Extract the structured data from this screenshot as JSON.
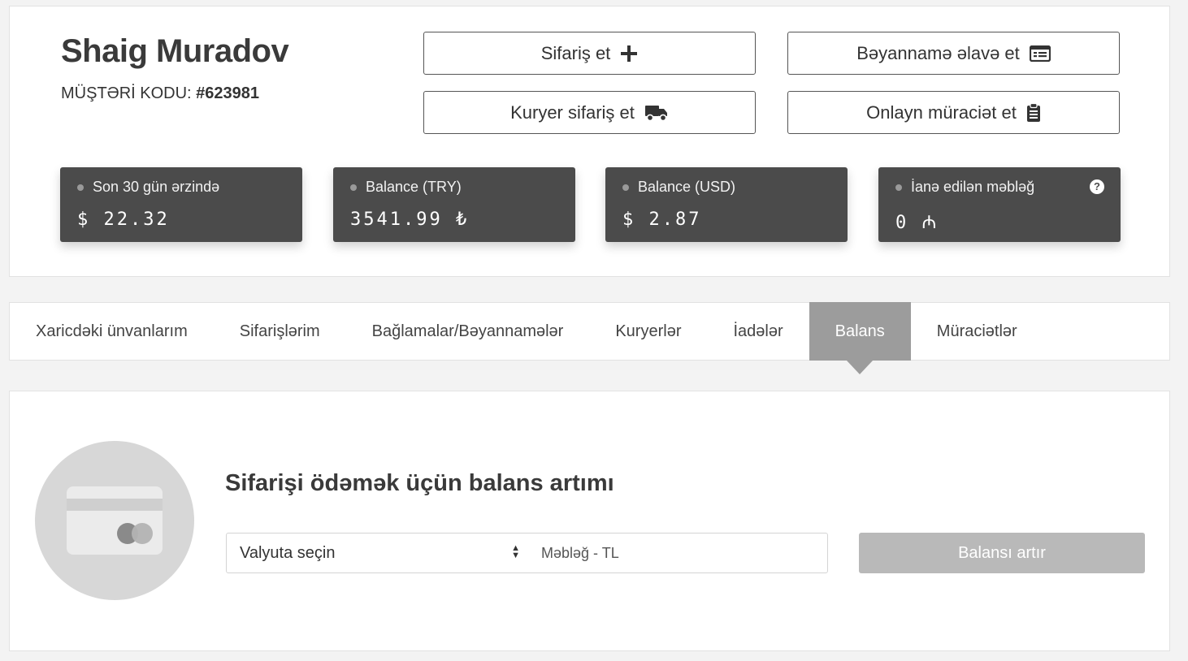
{
  "profile": {
    "name": "Shaig Muradov",
    "customer_code_label": "MÜŞTƏRİ KODU:",
    "customer_code": "#623981"
  },
  "actions": {
    "order_label": "Sifariş et",
    "declaration_label": "Bəyannamə əlavə et",
    "courier_label": "Kuryer sifariş et",
    "online_request_label": "Onlayn müraciət et"
  },
  "stats": [
    {
      "label": "Son 30 gün ərzində",
      "value": "$ 22.32"
    },
    {
      "label": "Balance (TRY)",
      "value": "3541.99 ₺"
    },
    {
      "label": "Balance (USD)",
      "value": "$ 2.87"
    },
    {
      "label": "İanə edilən məbləğ",
      "value": "0 ₼",
      "help": "?"
    }
  ],
  "tabs": [
    {
      "label": "Xaricdəki ünvanlarım"
    },
    {
      "label": "Sifarişlərim"
    },
    {
      "label": "Bağlamalar/Bəyannamələr"
    },
    {
      "label": "Kuryerlər"
    },
    {
      "label": "İadələr"
    },
    {
      "label": "Balans",
      "active": true
    },
    {
      "label": "Müraciətlər"
    }
  ],
  "balance": {
    "title": "Sifarişi ödəmək üçün balans artımı",
    "currency_select_value": "Valyuta seçin",
    "amount_placeholder": "Məbləğ - TL",
    "submit_label": "Balansı artır"
  },
  "icons": {
    "order": "plus-icon",
    "declaration": "list-card-icon",
    "courier": "truck-icon",
    "online_request": "clipboard-icon",
    "help": "question-circle-icon"
  },
  "colors": {
    "stat_background": "#4b4b4b",
    "active_tab": "#9c9c9c",
    "submit_button": "#b9b9b9"
  }
}
